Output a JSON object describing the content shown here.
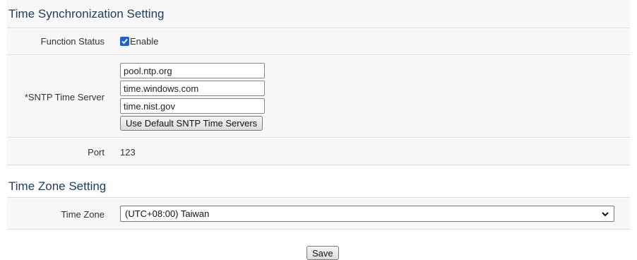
{
  "time_sync": {
    "title": "Time Synchronization Setting",
    "function_status": {
      "label": "Function Status",
      "checkbox_label": "Enable",
      "checked": true
    },
    "sntp": {
      "label": "*SNTP Time Server",
      "servers": [
        "pool.ntp.org",
        "time.windows.com",
        "time.nist.gov"
      ],
      "default_button": "Use Default SNTP Time Servers"
    },
    "port": {
      "label": "Port",
      "value": "123"
    }
  },
  "time_zone": {
    "title": "Time Zone Setting",
    "label": "Time Zone",
    "selected": "(UTC+08:00) Taiwan",
    "icon": "chevron-down-icon"
  },
  "save_label": "Save",
  "colors": {
    "title": "#1f3d60",
    "row_bg": "#f7f7f7",
    "checkbox": "#1f5fcf"
  }
}
